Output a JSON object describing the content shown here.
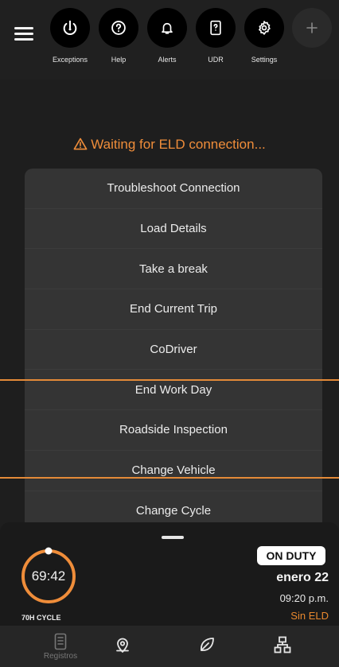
{
  "toolbar": {
    "items": [
      {
        "label": "Exceptions",
        "icon": "power-alert-icon"
      },
      {
        "label": "Help",
        "icon": "help-icon"
      },
      {
        "label": "Alerts",
        "icon": "bell-icon"
      },
      {
        "label": "UDR",
        "icon": "document-icon"
      },
      {
        "label": "Settings",
        "icon": "gear-icon"
      }
    ],
    "add_icon": "plus-icon"
  },
  "status_message": "Waiting for ELD connection...",
  "menu": {
    "items": [
      {
        "label": "Troubleshoot Connection"
      },
      {
        "label": "Load Details"
      },
      {
        "label": "Take a break"
      },
      {
        "label": "End Current Trip"
      },
      {
        "label": "CoDriver"
      },
      {
        "label": "End Work Day"
      },
      {
        "label": "Roadside Inspection"
      },
      {
        "label": "Change Vehicle"
      },
      {
        "label": "Change Cycle"
      }
    ]
  },
  "cycle": {
    "time": "69:42",
    "label": "70H CYCLE"
  },
  "duty": {
    "status": "ON DUTY",
    "date": "enero 22",
    "time": "09:20 p.m.",
    "eld_status": "Sin ELD"
  },
  "bottom_nav": {
    "items": [
      {
        "label": "Registros",
        "icon": "logbook-icon"
      },
      {
        "label": "",
        "icon": "map-pin-icon"
      },
      {
        "label": "",
        "icon": "leaf-icon"
      },
      {
        "label": "",
        "icon": "hierarchy-icon"
      }
    ]
  },
  "colors": {
    "accent": "#ef8d3a",
    "background": "#1e1e1e",
    "menu": "#343434"
  }
}
